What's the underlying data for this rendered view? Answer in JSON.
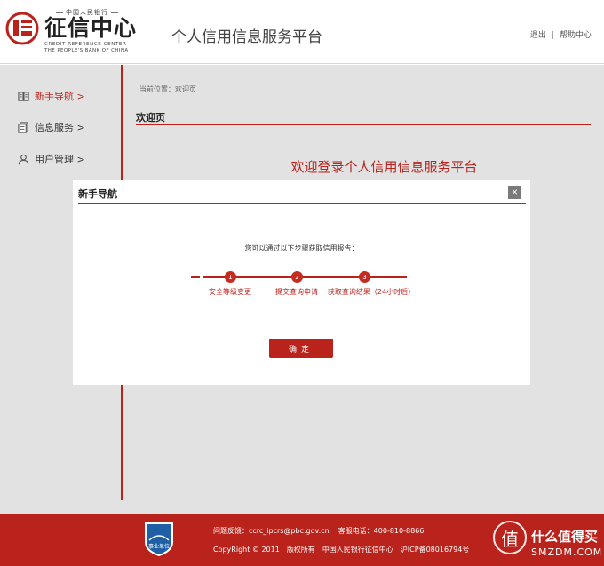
{
  "header": {
    "logo_cn_top": "中国人民银行",
    "logo_cn": "征信中心",
    "logo_en_line1": "CREDIT REFERENCE CENTER",
    "logo_en_line2": "THE PEOPLE'S BANK OF CHINA",
    "site_title": "个人信用信息服务平台",
    "logout_label": "退出",
    "separator": "|",
    "help_label": "帮助中心"
  },
  "sidebar": {
    "items": [
      {
        "label": "新手导航 >",
        "icon": "book-icon",
        "active": true
      },
      {
        "label": "信息服务 >",
        "icon": "document-icon",
        "active": false
      },
      {
        "label": "用户管理 >",
        "icon": "user-icon",
        "active": false
      }
    ]
  },
  "main": {
    "breadcrumb": "当前位置：欢迎页",
    "heading": "欢迎页",
    "welcome_title": "欢迎登录个人信用信息服务平台"
  },
  "modal": {
    "title": "新手导航",
    "close_symbol": "×",
    "description": "您可以通过以下步骤获取信用报告：",
    "steps": [
      {
        "number": "1",
        "label": "安全等级变更"
      },
      {
        "number": "2",
        "label": "提交查询申请"
      },
      {
        "number": "3",
        "label": "获取查询结果（24小时后）"
      }
    ],
    "confirm_label": "确定"
  },
  "footer": {
    "badge_text": "事业单位",
    "feedback": "问题反馈：ccrc_ipcrs@pbc.gov.cn",
    "phone": "客服电话：400-810-8866",
    "copyright": "CopyRight © 2011",
    "rights": "版权所有",
    "owner": "中国人民银行征信中心",
    "icp": "沪ICP备08016794号"
  },
  "watermark": {
    "glyph": "值",
    "cn": "什么值得买",
    "en": "SMZDM.COM"
  },
  "colors": {
    "brand_red": "#b9231c",
    "backdrop_gray": "#e2e2e2"
  }
}
